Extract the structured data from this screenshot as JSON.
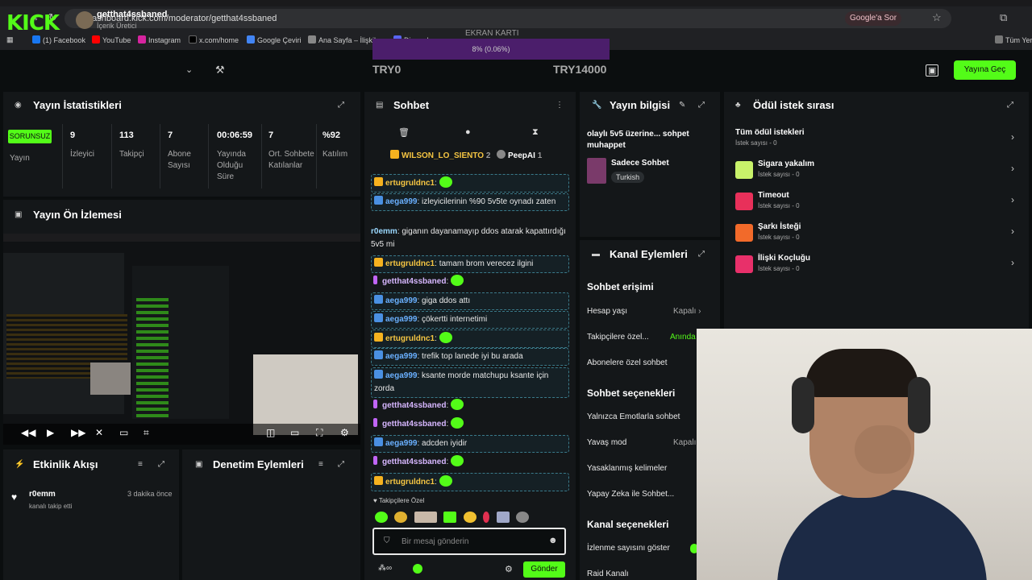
{
  "browser": {
    "url": "dashboard.kick.com/moderator/getthat4ssbaned",
    "google_search": "Google'a Sor",
    "bookmarks": [
      "(1) Facebook",
      "YouTube",
      "Instagram",
      "x.com/home",
      "Google Çeviri",
      "Ana Sayfa – İlişkile...",
      "Discord"
    ],
    "all_bookmarks": "Tüm Yer"
  },
  "header": {
    "logo": "KICK",
    "username": "getthat4ssbaned",
    "role": "İçerik Üretici",
    "gpu_title": "EKRAN KARTI",
    "gpu_value": "8% (0.06%)",
    "goal_left": "TRY0",
    "goal_right": "TRY14000",
    "go_live": "Yayına Geç"
  },
  "stats": {
    "title": "Yayın İstatistikleri",
    "status_badge": "SORUNSUZ",
    "status_label": "Yayın",
    "items": [
      {
        "value": "9",
        "label": "İzleyici"
      },
      {
        "value": "113",
        "label": "Takipçi"
      },
      {
        "value": "7",
        "label": "Abone Sayısı"
      },
      {
        "value": "00:06:59",
        "label": "Yayında Olduğu Süre"
      },
      {
        "value": "7",
        "label": "Ort. Sohbete Katılanlar"
      },
      {
        "value": "%92",
        "label": "Katılım"
      }
    ]
  },
  "preview": {
    "title": "Yayın Ön İzlemesi"
  },
  "activity": {
    "title": "Etkinlik Akışı",
    "item_user": "r0emm",
    "item_action": "kanalı takip etti",
    "item_time": "3 dakika önce"
  },
  "moderation": {
    "title": "Denetim Eylemleri"
  },
  "chat": {
    "title": "Sohbet",
    "pinned_user_1": "WILSON_LO_SIENTO",
    "pinned_count_1": "2",
    "pinned_user_2": "PeepAI",
    "pinned_count_2": "1",
    "messages": [
      {
        "user": "ertugruldnc1",
        "text": ""
      },
      {
        "user": "aega999",
        "text": "izleyicilerinin %90 5v5te oynadı zaten"
      },
      {
        "user": "r0emm",
        "text": "giganın dayanamayıp ddos atarak kapattırdığı 5v5 mi"
      },
      {
        "user": "ertugruldnc1",
        "text": "tamam brom verecez ilgini"
      },
      {
        "user": "getthat4ssbaned",
        "text": ""
      },
      {
        "user": "aega999",
        "text": "giga ddos attı"
      },
      {
        "user": "aega999",
        "text": "çökertti internetimi"
      },
      {
        "user": "ertugruldnc1",
        "text": ""
      },
      {
        "user": "aega999",
        "text": "trefik top lanede iyi bu arada"
      },
      {
        "user": "aega999",
        "text": "ksante morde matchupu ksante için zorda"
      },
      {
        "user": "getthat4ssbaned",
        "text": ""
      },
      {
        "user": "getthat4ssbaned",
        "text": ""
      },
      {
        "user": "aega999",
        "text": "adcden iyidir"
      },
      {
        "user": "getthat4ssbaned",
        "text": ""
      },
      {
        "user": "ertugruldnc1",
        "text": ""
      }
    ],
    "followers_only": "Takipçilere Özel",
    "input_placeholder": "Bir mesaj gönderin",
    "send": "Gönder"
  },
  "stream_info": {
    "title": "Yayın bilgisi",
    "stream_title": "olaylı 5v5 üzerine... sohpet muhappet",
    "category": "Sadece Sohbet",
    "language": "Turkish"
  },
  "channel_actions": {
    "title": "Kanal Eylemleri",
    "chat_access": "Sohbet erişimi",
    "account_age": "Hesap yaşı",
    "account_age_value": "Kapalı",
    "followers_only": "Takipçilere özel...",
    "followers_only_value": "Anında",
    "subscribers_only": "Abonelere özel sohbet",
    "chat_options": "Sohbet seçenekleri",
    "emotes_only": "Yalnızca Emotlarla sohbet",
    "slow_mode": "Yavaş mod",
    "slow_mode_value": "Kapalı",
    "banned_words": "Yasaklanmış kelimeler",
    "ai_chat": "Yapay Zeka ile Sohbet...",
    "channel_options": "Kanal seçenekleri",
    "show_viewers": "İzlenme sayısını göster",
    "raid": "Raid Kanalı"
  },
  "rewards": {
    "title": "Ödül istek sırası",
    "items": [
      {
        "name": "Tüm ödül istekleri",
        "count": "İstek sayısı - 0",
        "color": ""
      },
      {
        "name": "Sigara yakalım",
        "count": "İstek sayısı - 0",
        "color": "#c8f26a"
      },
      {
        "name": "Timeout",
        "count": "İstek sayısı - 0",
        "color": "#e8305a"
      },
      {
        "name": "Şarkı İsteği",
        "count": "İstek sayısı - 0",
        "color": "#f26a2a"
      },
      {
        "name": "İlişki Koçluğu",
        "count": "İstek sayısı - 0",
        "color": "#e8306a"
      }
    ]
  },
  "colors": {
    "accent": "#53fc18",
    "panel": "#141719",
    "background": "#0b0e0f"
  }
}
